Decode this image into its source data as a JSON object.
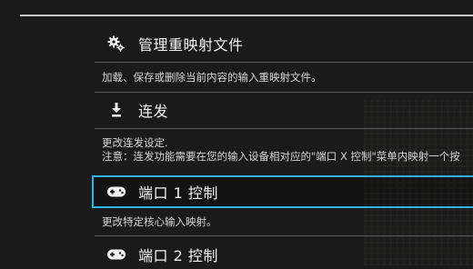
{
  "menu": {
    "items": [
      {
        "icon": "gears-icon",
        "label": "管理重映射文件",
        "descriptions": [
          "加载、保存或删除当前内容的输入重映射文件。"
        ]
      },
      {
        "icon": "download-arrow-icon",
        "label": "连发",
        "descriptions": [
          "更改连发设定.",
          "注意：连发功能需要在您的输入设备相对应的\"端口 X 控制\"菜单内映射一个按"
        ]
      },
      {
        "icon": "gamepad-icon",
        "label": "端口 1 控制",
        "descriptions": [
          "更改特定核心输入映射。"
        ],
        "selected": true
      },
      {
        "icon": "gamepad-icon",
        "label": "端口 2 控制",
        "descriptions": []
      }
    ]
  },
  "colors": {
    "selection": "#2ab6ea",
    "background": "#1a1a1a"
  }
}
